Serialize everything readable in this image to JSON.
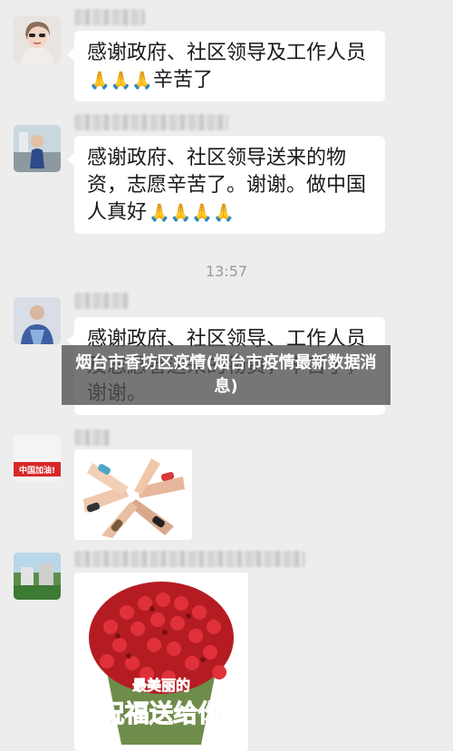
{
  "chat": {
    "messages": [
      {
        "text": "感谢政府、社区领导及工作人员",
        "text_line2": "辛苦了",
        "emoji": "pray"
      },
      {
        "text": "感谢政府、社区领导送来的物\n资，志愿辛苦了。谢谢。做中国\n人真好",
        "emoji": "pray"
      },
      {
        "text": "感谢政府、社区领导、工作人员\n及志愿者送来的物资，辛苦了，\n谢谢。"
      }
    ],
    "timestamp": "13:57",
    "avatar_badge": "中国加油!",
    "image_caption_line1": "最美丽的",
    "image_caption_line2": "祝福送给你"
  },
  "overlay": {
    "title": "烟台市香坊区疫情(烟台市疫情最新数据消息)"
  },
  "colors": {
    "background": "#ededed",
    "bubble": "#ffffff",
    "overlay": "#505050",
    "caption_red": "#d42a2a"
  }
}
